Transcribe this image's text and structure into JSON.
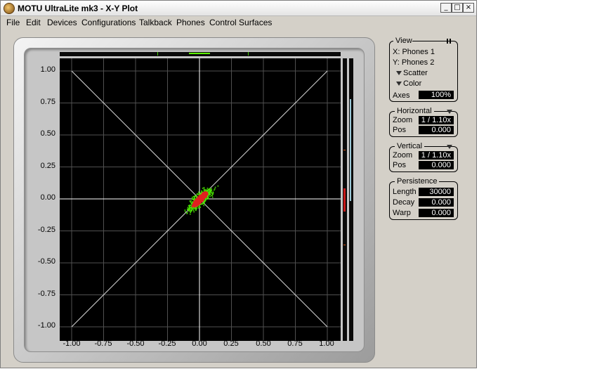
{
  "window": {
    "title": "MOTU UltraLite mk3 - X-Y Plot"
  },
  "titlebar_buttons": {
    "minimize": "_",
    "maximize": "□",
    "close": "×"
  },
  "menu": [
    "File",
    "Edit",
    "Devices",
    "Configurations",
    "Talkback",
    "Phones",
    "Control Surfaces"
  ],
  "plot": {
    "y_ticks": [
      "1.00",
      "0.75",
      "0.50",
      "0.25",
      "0.00",
      "-0.25",
      "-0.50",
      "-0.75",
      "-1.00"
    ],
    "x_ticks": [
      "-1.00",
      "-0.75",
      "-0.50",
      "-0.25",
      "0.00",
      "0.25",
      "0.50",
      "0.75",
      "1.00"
    ],
    "x_range": [
      -1.0,
      1.0
    ],
    "y_range": [
      -1.0,
      1.0
    ],
    "colors": {
      "background": "#000000",
      "grid": "#505050",
      "axes": "#ffffff",
      "scatter_outer": "#48e000",
      "scatter_core": "#e02020",
      "meter": "#9ac8d8"
    }
  },
  "panel": {
    "view": {
      "title": "View",
      "x_source": "X: Phones 1",
      "y_source": "Y: Phones 2",
      "scatter_label": "Scatter",
      "color_label": "Color",
      "axes_label": "Axes",
      "axes_value": "100%"
    },
    "horizontal": {
      "title": "Horizontal",
      "zoom_label": "Zoom",
      "zoom_value": "1 / 1.10x",
      "pos_label": "Pos",
      "pos_value": "0.000"
    },
    "vertical": {
      "title": "Vertical",
      "zoom_label": "Zoom",
      "zoom_value": "1 / 1.10x",
      "pos_label": "Pos",
      "pos_value": "0.000"
    },
    "persistence": {
      "title": "Persistence",
      "length_label": "Length",
      "length_value": "30000",
      "decay_label": "Decay",
      "decay_value": "0.000",
      "warp_label": "Warp",
      "warp_value": "0.000"
    }
  }
}
